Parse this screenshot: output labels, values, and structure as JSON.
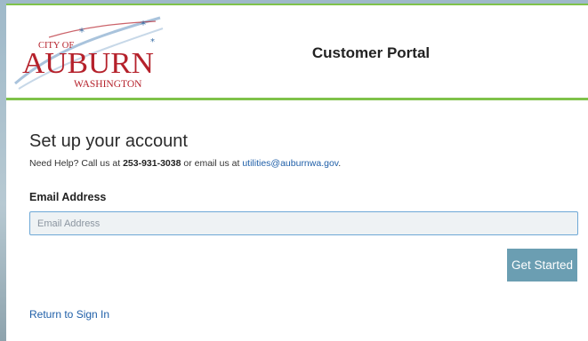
{
  "header": {
    "logo": {
      "top": "CITY OF",
      "main": "AUBURN",
      "sub": "WASHINGTON"
    },
    "title": "Customer Portal"
  },
  "form": {
    "heading": "Set up your account",
    "help": {
      "prefix": "Need Help? Call us at ",
      "phone": "253-931-3038",
      "middle": " or email us at ",
      "email": "utilities@auburnwa.gov",
      "suffix": "."
    },
    "email_label": "Email Address",
    "email_placeholder": "Email Address",
    "email_value": "",
    "submit_label": "Get Started",
    "return_link": "Return to Sign In"
  },
  "colors": {
    "accent_green": "#7fc24a",
    "button": "#6b9eb2",
    "link": "#1f5fa8",
    "logo_red": "#b5212b",
    "logo_blue": "#3a6ea5"
  }
}
